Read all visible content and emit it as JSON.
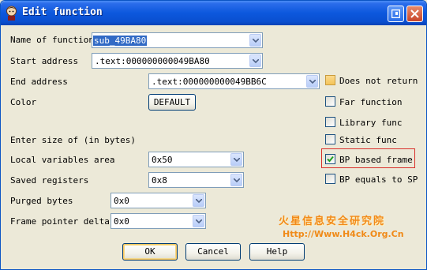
{
  "window": {
    "title": "Edit function",
    "controls": {
      "restore_icon": "restore-icon",
      "close_icon": "close-icon"
    }
  },
  "fields": {
    "name": {
      "label": "Name of function",
      "value": "sub_49BA80"
    },
    "start": {
      "label": "Start address",
      "value": ".text:000000000049BA80"
    },
    "end": {
      "label": "End address",
      "value": ".text:000000000049BB6C"
    },
    "color": {
      "label": "Color",
      "button": "DEFAULT"
    },
    "size_header": "Enter size of (in bytes)",
    "local_vars": {
      "label": "Local variables area",
      "value": "0x50"
    },
    "saved_regs": {
      "label": "Saved registers",
      "value": "0x8"
    },
    "purged": {
      "label": "Purged bytes",
      "value": "0x0"
    },
    "fp_delta": {
      "label": "Frame pointer delta",
      "value": "0x0"
    }
  },
  "options": [
    {
      "label": "Does not return",
      "checked": false
    },
    {
      "label": "Far function",
      "checked": false
    },
    {
      "label": "Library func",
      "checked": false
    },
    {
      "label": "Static func",
      "checked": false
    },
    {
      "label": "BP based frame",
      "checked": true
    },
    {
      "label": "BP equals to SP",
      "checked": false
    }
  ],
  "buttons": {
    "ok": "OK",
    "cancel": "Cancel",
    "help": "Help"
  },
  "watermark": {
    "text": "火星信息安全研究院",
    "url": "Http://Www.H4ck.Org.Cn"
  },
  "colors": {
    "title_bar": "#0c58dd",
    "highlight_border": "#d9302b",
    "watermark": "#f28a1a"
  }
}
